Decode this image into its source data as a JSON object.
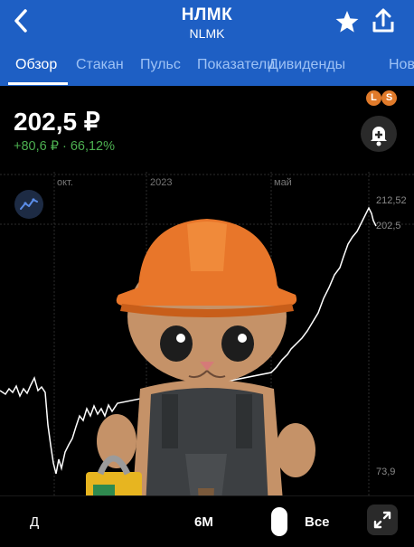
{
  "header": {
    "title": "НЛМК",
    "subtitle": "NLMK",
    "tabs": [
      {
        "label": "Обзор",
        "active": true
      },
      {
        "label": "Стакан"
      },
      {
        "label": "Пульс"
      },
      {
        "label": "Показатели"
      },
      {
        "label": "Дивиденды"
      },
      {
        "label": "Нов"
      }
    ]
  },
  "quote": {
    "price": "202,5 ₽",
    "change": "+80,6 ₽ · 66,12%"
  },
  "badges": {
    "l": "L",
    "s": "S"
  },
  "chart": {
    "x_labels": [
      "окт.",
      "2023",
      "май"
    ],
    "y_labels": [
      "212,52",
      "202,5",
      "73,9"
    ]
  },
  "periods": {
    "left": "Д",
    "selected": "6М",
    "all": "Все"
  },
  "colors": {
    "accent": "#1e5fc4",
    "positive": "#4caf50",
    "badge": "#e07a2a"
  }
}
